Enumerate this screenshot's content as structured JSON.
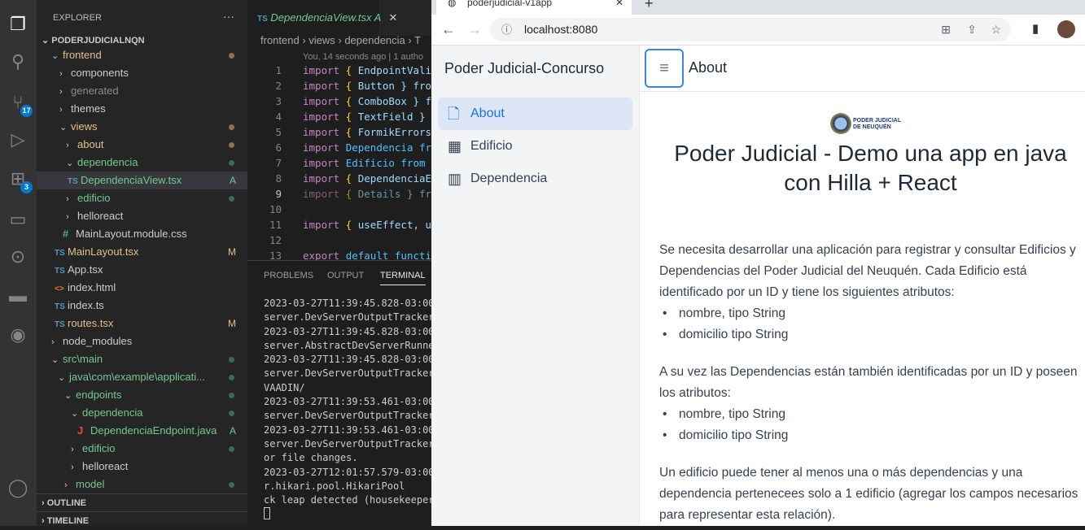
{
  "vscode": {
    "activity": [
      {
        "icon": "files-icon"
      },
      {
        "icon": "search-icon"
      },
      {
        "icon": "source-control-icon",
        "badge": "17"
      },
      {
        "icon": "run-debug-icon"
      },
      {
        "icon": "extensions-icon",
        "badge": "3"
      },
      {
        "icon": "remote-explorer-icon"
      },
      {
        "icon": "git-graph-icon"
      },
      {
        "icon": "docker-icon"
      },
      {
        "icon": "github-icon"
      },
      {
        "icon": "account-icon"
      }
    ],
    "explorer": {
      "title": "EXPLORER",
      "more": "···",
      "root": "PODERJUDICIALNQN",
      "outline": "OUTLINE",
      "timeline": "TIMELINE",
      "items": [
        {
          "label": "frontend",
          "indent": 18,
          "chev": "⌄",
          "color": "#e2c08d",
          "dot": "#8a7353"
        },
        {
          "label": "components",
          "indent": 28,
          "chev": "›",
          "color": "#cccccc"
        },
        {
          "label": "generated",
          "indent": 28,
          "chev": "›",
          "color": "#8c8c8c"
        },
        {
          "label": "themes",
          "indent": 28,
          "chev": "›",
          "color": "#cccccc"
        },
        {
          "label": "views",
          "indent": 28,
          "chev": "⌄",
          "color": "#e2c08d",
          "dot": "#8a7353"
        },
        {
          "label": "about",
          "indent": 36,
          "chev": "›",
          "color": "#e2c08d",
          "dot": "#8a7353"
        },
        {
          "label": "dependencia",
          "indent": 36,
          "chev": "⌄",
          "color": "#73c991",
          "dot": "#3e6b4e"
        },
        {
          "label": "DependenciaView.tsx",
          "indent": 38,
          "icon": "TS",
          "color": "#73c991",
          "status": "A",
          "sel": true
        },
        {
          "label": "edificio",
          "indent": 36,
          "chev": "›",
          "color": "#73c991",
          "dot": "#3e6b4e"
        },
        {
          "label": "helloreact",
          "indent": 36,
          "chev": "›",
          "color": "#cccccc"
        },
        {
          "label": "MainLayout.module.css",
          "indent": 32,
          "icon": "#",
          "color": "#cccccc"
        },
        {
          "label": "MainLayout.tsx",
          "indent": 22,
          "icon": "TS",
          "color": "#e2c08d",
          "status": "M"
        },
        {
          "label": "App.tsx",
          "indent": 22,
          "icon": "TS",
          "color": "#cccccc"
        },
        {
          "label": "index.html",
          "indent": 22,
          "icon": "<>",
          "color": "#cccccc"
        },
        {
          "label": "index.ts",
          "indent": 22,
          "icon": "TS",
          "color": "#cccccc"
        },
        {
          "label": "routes.tsx",
          "indent": 22,
          "icon": "TS",
          "color": "#e2c08d",
          "status": "M"
        },
        {
          "label": "node_modules",
          "indent": 18,
          "chev": "›",
          "color": "#cccccc"
        },
        {
          "label": "src\\main",
          "indent": 18,
          "chev": "⌄",
          "color": "#73c991",
          "dot": "#3e6b4e"
        },
        {
          "label": "java\\com\\example\\applicati...",
          "indent": 26,
          "chev": "⌄",
          "color": "#73c991",
          "dot": "#3e6b4e"
        },
        {
          "label": "endpoints",
          "indent": 34,
          "chev": "⌄",
          "color": "#73c991",
          "dot": "#3e6b4e"
        },
        {
          "label": "dependencia",
          "indent": 42,
          "chev": "⌄",
          "color": "#73c991",
          "dot": "#3e6b4e"
        },
        {
          "label": "DependenciaEndpoint.java",
          "indent": 50,
          "icon": "J",
          "color": "#73c991",
          "status": "A"
        },
        {
          "label": "edificio",
          "indent": 42,
          "chev": "›",
          "color": "#73c991",
          "dot": "#3e6b4e"
        },
        {
          "label": "helloreact",
          "indent": 42,
          "chev": "›",
          "color": "#cccccc"
        },
        {
          "label": "model",
          "indent": 34,
          "chev": "›",
          "color": "#73c991",
          "dot": "#3e6b4e"
        }
      ]
    },
    "editor": {
      "tab": {
        "icon": "TS",
        "label": "DependenciaView.tsx",
        "status": "A",
        "close": "✕"
      },
      "breadcrumb": "frontend › views › dependencia › T",
      "blame": "You, 14 seconds ago | 1 autho",
      "lines": [
        {
          "n": "1",
          "kw": "import",
          "br": " { ",
          "id": "EndpointVali"
        },
        {
          "n": "2",
          "kw": "import",
          "br": " { ",
          "id": "Button } fro"
        },
        {
          "n": "3",
          "kw": "import",
          "br": " { ",
          "id": "ComboBox } f"
        },
        {
          "n": "4",
          "kw": "import",
          "br": " { ",
          "id": "TextField }"
        },
        {
          "n": "5",
          "kw": "import",
          "br": " { ",
          "id": "FormikErrors"
        },
        {
          "n": "6",
          "kw": "import",
          "br": " ",
          "id": "Dependencia fr"
        },
        {
          "n": "7",
          "kw": "import",
          "br": " ",
          "id": "Edificio from"
        },
        {
          "n": "8",
          "kw": "import",
          "br": " { ",
          "id": "DependenciaE"
        },
        {
          "n": "9",
          "kw": "import",
          "br": " { ",
          "id": "Details } fr"
        },
        {
          "n": "10",
          "kw": "",
          "br": "",
          "id": ""
        },
        {
          "n": "11",
          "kw": "import",
          "br": " { ",
          "id": "useEffect, u"
        },
        {
          "n": "12",
          "kw": "",
          "br": "",
          "id": ""
        },
        {
          "n": "13",
          "kw": "export",
          "br": " ",
          "id": "default functi"
        }
      ]
    },
    "panel": {
      "tabs": [
        "PROBLEMS",
        "OUTPUT",
        "TERMINAL"
      ],
      "terminal": [
        "2023-03-27T11:39:45.828-03:00",
        "server.DevServerOutputTracker",
        "2023-03-27T11:39:45.828-03:00",
        "server.AbstractDevServerRunner",
        "2023-03-27T11:39:45.828-03:00",
        "server.DevServerOutputTracker",
        "VAADIN/",
        "2023-03-27T11:39:53.461-03:00",
        "server.DevServerOutputTracker",
        "2023-03-27T11:39:53.461-03:00",
        "server.DevServerOutputTracker",
        "or file changes.",
        "2023-03-27T12:01:57.579-03:00",
        "r.hikari.pool.HikariPool",
        "ck leap detected (housekeeper"
      ]
    }
  },
  "browser": {
    "tab_title": "poderjudicial-v1app",
    "url": "localhost:8080",
    "app": {
      "title": "Poder Judicial-Concurso",
      "nav": [
        {
          "label": "About",
          "icon": "file-icon",
          "active": true
        },
        {
          "label": "Edificio",
          "icon": "building-icon"
        },
        {
          "label": "Dependencia",
          "icon": "buildings-icon"
        }
      ],
      "header": "About",
      "logo": [
        "PODER JUDICIAL",
        "DE NEUQUÉN"
      ],
      "heading": "Poder Judicial - Demo una app en java con Hilla + React",
      "p1": "Se necesita desarrollar una aplicación para registrar y consultar Edificios y Dependencias del Poder Judicial del Neuquén. Cada Edificio está identificado por un ID y tiene los siguientes atributos:",
      "list1": [
        "nombre, tipo String",
        "domicilio tipo String"
      ],
      "p2": "A su vez las Dependencias están también identificadas por un ID y poseen los atributos:",
      "list2": [
        "nombre, tipo String",
        "domicilio tipo String"
      ],
      "p3": "Un edificio puede tener al menos una o más dependencias y una dependencia pertenecees solo a 1 edificio (agregar los campos necesarios para representar esta relación)."
    }
  }
}
